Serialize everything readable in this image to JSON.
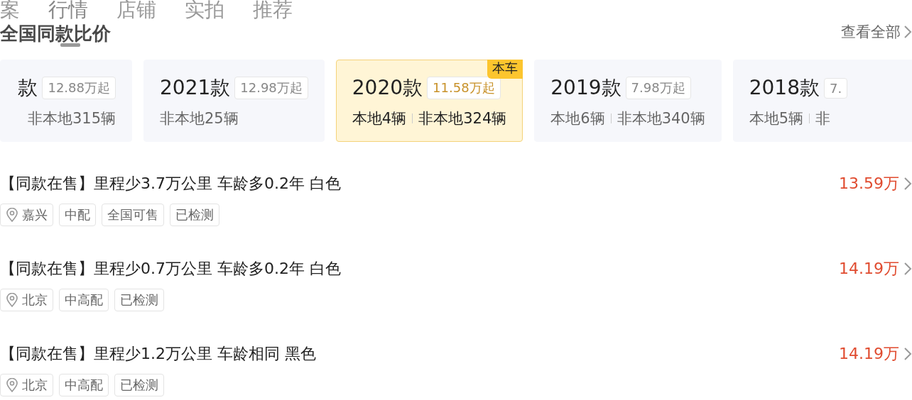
{
  "tabs": [
    {
      "label": "案",
      "selected": false
    },
    {
      "label": "行情",
      "selected": true
    },
    {
      "label": "店铺",
      "selected": false
    },
    {
      "label": "实拍",
      "selected": false
    },
    {
      "label": "推荐",
      "selected": false
    }
  ],
  "section_title": "全国同款比价",
  "view_all": "查看全部",
  "years": [
    {
      "year": "款",
      "price": "12.88万起",
      "nonlocal": "非本地315辆",
      "selected": false
    },
    {
      "year": "2021款",
      "price": "12.98万起",
      "nonlocal": "非本地25辆",
      "selected": false
    },
    {
      "year": "2020款",
      "price": "11.58万起",
      "local": "本地4辆",
      "nonlocal": "非本地324辆",
      "selected": true,
      "badge": "本车"
    },
    {
      "year": "2019款",
      "price": "7.98万起",
      "local": "本地6辆",
      "nonlocal": "非本地340辆",
      "selected": false
    },
    {
      "year": "2018款",
      "price": "7.",
      "local": "本地5辆",
      "nonlocal": "非",
      "selected": false
    }
  ],
  "listings": [
    {
      "title": "【同款在售】里程少3.7万公里 车龄多0.2年 白色",
      "price": "13.59万",
      "location": "嘉兴",
      "tags": [
        "中配",
        "全国可售",
        "已检测"
      ]
    },
    {
      "title": "【同款在售】里程少0.7万公里 车龄多0.2年 白色",
      "price": "14.19万",
      "location": "北京",
      "tags": [
        "中高配",
        "已检测"
      ]
    },
    {
      "title": "【同款在售】里程少1.2万公里 车龄相同 黑色",
      "price": "14.19万",
      "location": "北京",
      "tags": [
        "中高配",
        "已检测"
      ]
    }
  ]
}
